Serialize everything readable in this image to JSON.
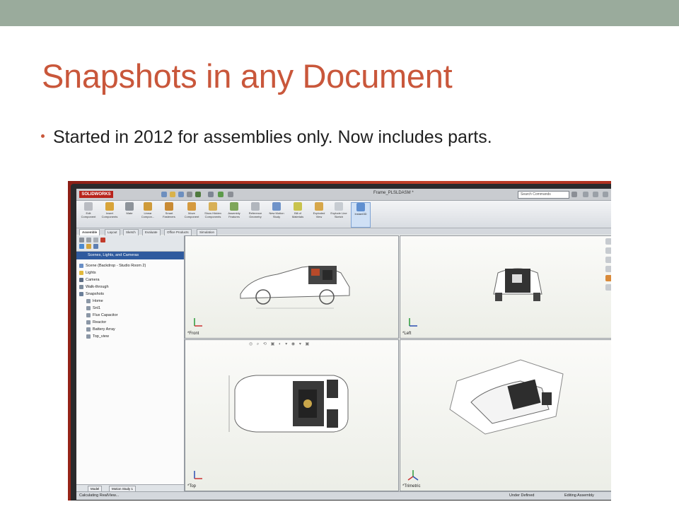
{
  "slide": {
    "title": "Snapshots in any Document",
    "bullets": [
      "Started in 2012 for assemblies only. Now includes parts."
    ],
    "colors": {
      "title": "#c9573b",
      "top_band": "#9aab9c",
      "text": "#1f1f1f"
    }
  },
  "screenshot": {
    "app_logo": "SOLIDWORKS",
    "file_title": "Frame_PLSLDASM *",
    "search_placeholder": "Search Commands",
    "ribbon": [
      {
        "label": "Edit Component",
        "icon": "edit-component-icon"
      },
      {
        "label": "Insert Components",
        "icon": "insert-components-icon"
      },
      {
        "label": "Mate",
        "icon": "mate-icon"
      },
      {
        "label": "Linear Compon...",
        "icon": "linear-pattern-icon"
      },
      {
        "label": "Smart Fasteners",
        "icon": "smart-fasteners-icon"
      },
      {
        "label": "Move Component",
        "icon": "move-component-icon"
      },
      {
        "label": "Show Hidden Components",
        "icon": "show-hidden-icon"
      },
      {
        "label": "Assembly Features",
        "icon": "assembly-features-icon"
      },
      {
        "label": "Reference Geometry",
        "icon": "reference-geometry-icon"
      },
      {
        "label": "New Motion Study",
        "icon": "motion-study-icon"
      },
      {
        "label": "Bill of Materials",
        "icon": "bom-icon"
      },
      {
        "label": "Exploded View",
        "icon": "exploded-view-icon"
      },
      {
        "label": "Explode Line Sketch",
        "icon": "explode-line-icon"
      },
      {
        "label": "Instant3D",
        "icon": "instant3d-icon"
      }
    ],
    "tabs": [
      "Assemble",
      "Layout",
      "Sketch",
      "Evaluate",
      "Office Products",
      "Simulation"
    ],
    "panel_header": "Scenes, Lights, and Cameras",
    "tree": [
      {
        "label": "Scene (Backdrop - Studio Room 2)",
        "indent": 0
      },
      {
        "label": "Lights",
        "indent": 0
      },
      {
        "label": "Camera",
        "indent": 0
      },
      {
        "label": "Walk-through",
        "indent": 0
      },
      {
        "label": "Snapshots",
        "indent": 0
      },
      {
        "label": "Home",
        "indent": 1
      },
      {
        "label": "Snl1",
        "indent": 1
      },
      {
        "label": "Flux Capacitor",
        "indent": 1
      },
      {
        "label": "Reactor",
        "indent": 1
      },
      {
        "label": "Battery Array",
        "indent": 1
      },
      {
        "label": "Top_view",
        "indent": 1
      }
    ],
    "bottom_tabs": [
      "Model",
      "Motion Study 1"
    ],
    "viewports": [
      "*Front",
      "*Left",
      "*Top",
      "*Trimetric"
    ],
    "status_left": "Calculating RealView...",
    "status_right": "Under Defined",
    "status_right2": "Editing Assembly"
  }
}
